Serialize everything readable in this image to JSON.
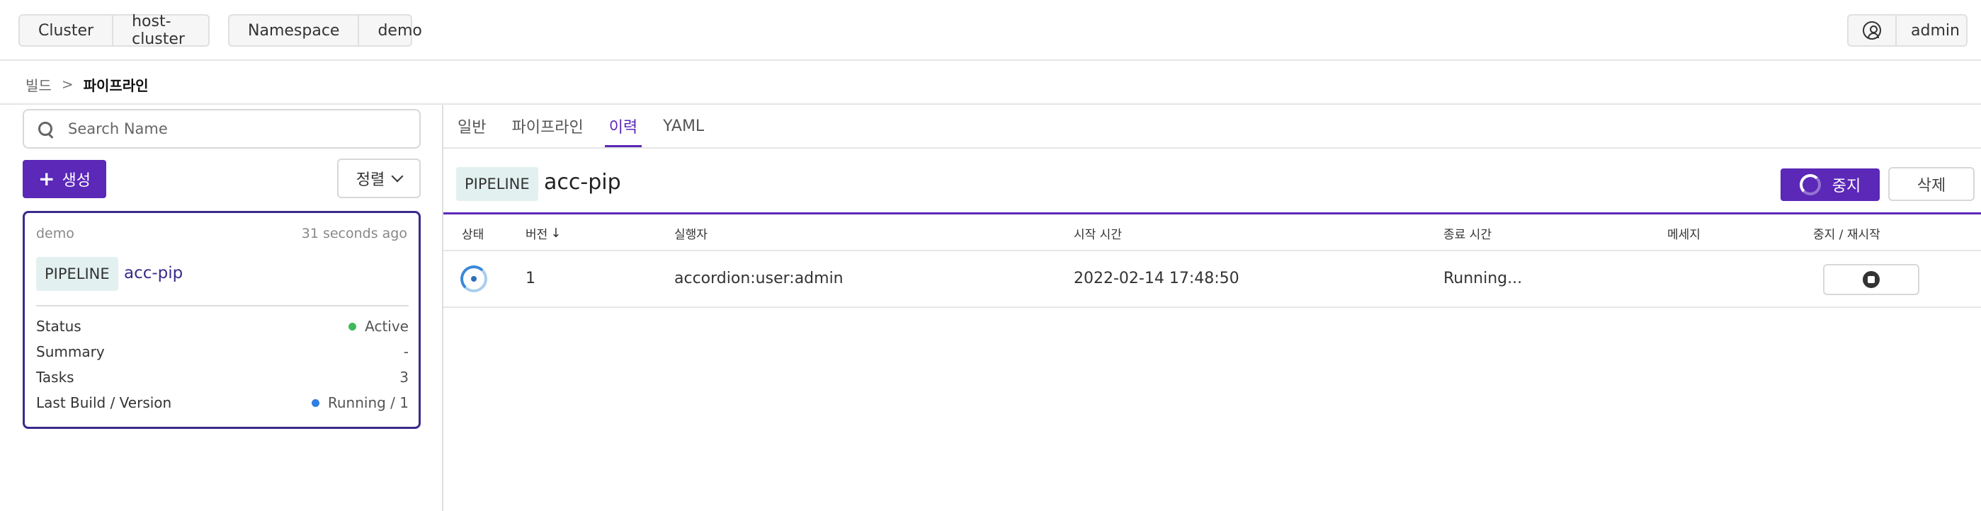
{
  "topbar": {
    "cluster_label": "Cluster",
    "cluster_value": "host-cluster",
    "namespace_label": "Namespace",
    "namespace_value": "demo",
    "user_name": "admin"
  },
  "breadcrumb": {
    "parent": "빌드",
    "separator": ">",
    "current": "파이프라인"
  },
  "sidebar": {
    "search_placeholder": "Search Name",
    "create_label": "생성",
    "create_icon": "+",
    "sort_label": "정렬",
    "card": {
      "namespace": "demo",
      "time": "31 seconds ago",
      "tag": "PIPELINE",
      "name": "acc-pip",
      "rows": [
        {
          "key": "Status",
          "value": "Active",
          "dot_color": "#3dbb5a"
        },
        {
          "key": "Summary",
          "value": "-"
        },
        {
          "key": "Tasks",
          "value": "3"
        },
        {
          "key": "Last Build / Version",
          "value": "Running / 1",
          "dot_color": "#2f7fe0"
        }
      ]
    }
  },
  "main": {
    "tabs": [
      {
        "label": "일반",
        "active": false
      },
      {
        "label": "파이프라인",
        "active": false
      },
      {
        "label": "이력",
        "active": true
      },
      {
        "label": "YAML",
        "active": false
      }
    ],
    "tag": "PIPELINE",
    "title": "acc-pip",
    "stop_label": "중지",
    "delete_label": "삭제",
    "table": {
      "headers": [
        "상태",
        "버전",
        "실행자",
        "시작 시간",
        "종료 시간",
        "메세지",
        "중지 / 재시작"
      ],
      "rows": [
        {
          "status": "running",
          "version": "1",
          "executor": "accordion:user:admin",
          "start_time": "2022-02-14 17:48:50",
          "end_time": "Running...",
          "message": ""
        }
      ]
    }
  },
  "colors": {
    "accent": "#5b28b8",
    "card_border": "#3b2a8c",
    "tag_bg": "#e2f1ef"
  }
}
